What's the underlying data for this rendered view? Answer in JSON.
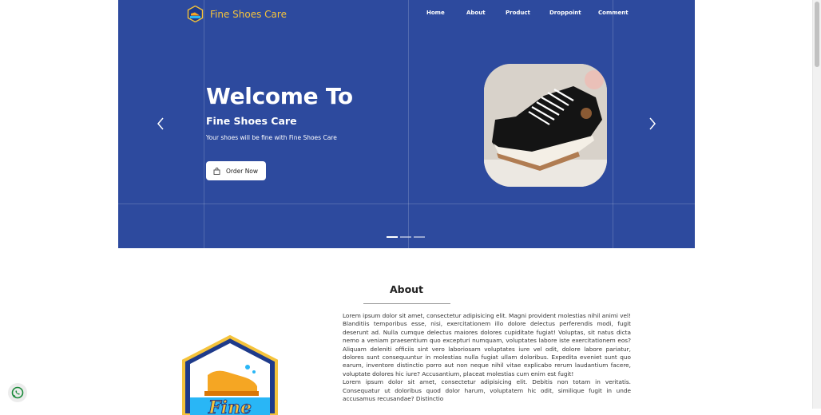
{
  "brand": {
    "name": "Fine Shoes Care",
    "logo_icon": "shoe-logo-icon"
  },
  "nav": {
    "items": [
      {
        "label": "Home"
      },
      {
        "label": "About"
      },
      {
        "label": "Product"
      },
      {
        "label": "Droppoint"
      },
      {
        "label": "Comment"
      }
    ]
  },
  "hero": {
    "title": "Welcome To",
    "subtitle": "Fine Shoes Care",
    "description": "Your shoes will be fine with Fine Shoes Care",
    "cta_label": "Order Now",
    "cta_icon": "shopping-bag-icon",
    "prev_icon": "chevron-left-icon",
    "next_icon": "chevron-right-icon",
    "slides_count": 3,
    "active_slide": 1
  },
  "about": {
    "title": "About",
    "paragraphs": [
      "Lorem ipsum dolor sit amet, consectetur adipisicing elit. Magni provident molestias nihil animi vel! Blanditiis temporibus esse, nisi, exercitationem illo dolore delectus perferendis modi, fugit deserunt ad. Nulla cumque delectus maiores dolores cupiditate fugiat! Voluptas, sit natus dicta nemo a veniam praesentium quo excepturi numquam, voluptates labore iste exercitationem eos? Aliquam deleniti officiis sint vero laboriosam voluptates iure vel odit, dolore labore pariatur, dolores sunt consequuntur in molestias nulla fugiat ullam doloribus. Expedita eveniet sunt quo earum, inventore distinctio porro aut non neque nihil vitae explicabo rerum laudantium facere, voluptate dolores hic iure? Accusantium, placeat molestias cum enim est fugit!",
      "Lorem ipsum dolor sit amet, consectetur adipisicing elit. Debitis non totam in veritatis. Consequatur ut doloribus quod dolor harum, voluptatem hic odit, similique fugit in unde accusamus recusandae? Distinctio"
    ]
  },
  "colors": {
    "hero_bg": "#2d4a9e",
    "brand_text": "#f5c33b",
    "white": "#ffffff"
  },
  "floating": {
    "whatsapp_icon": "whatsapp-icon"
  }
}
